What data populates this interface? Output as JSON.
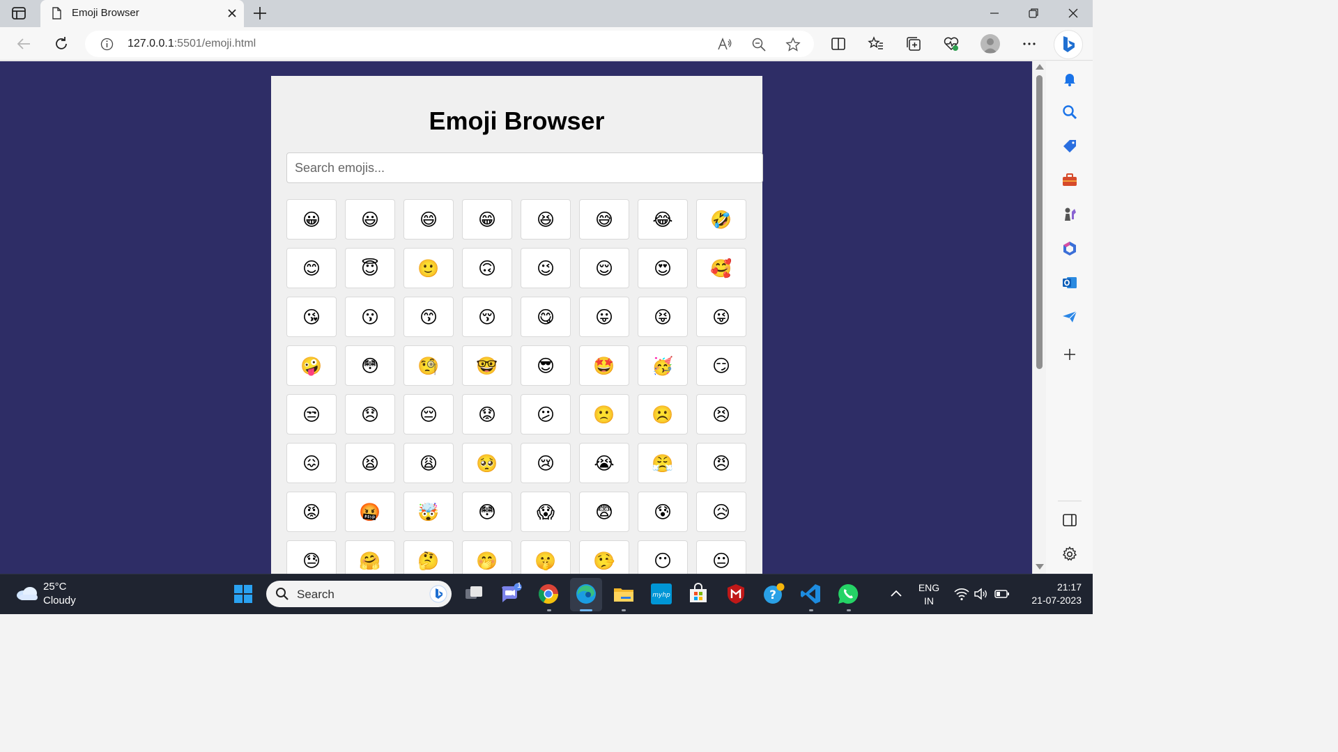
{
  "browser": {
    "tab_title": "Emoji Browser",
    "url_host": "127.0.0.1",
    "url_rest": ":5501/emoji.html"
  },
  "page": {
    "heading": "Emoji Browser",
    "search_placeholder": "Search emojis...",
    "emojis": [
      "😀",
      "😃",
      "😄",
      "😁",
      "😆",
      "😅",
      "😂",
      "🤣",
      "😊",
      "😇",
      "🙂",
      "🙃",
      "😉",
      "😌",
      "😍",
      "🥰",
      "😘",
      "😗",
      "😙",
      "😚",
      "😋",
      "😛",
      "😝",
      "😜",
      "🤪",
      "😳",
      "🧐",
      "🤓",
      "😎",
      "🤩",
      "🥳",
      "😏",
      "😒",
      "😞",
      "😔",
      "😟",
      "😕",
      "🙁",
      "☹️",
      "😣",
      "😖",
      "😫",
      "😩",
      "🥺",
      "😢",
      "😭",
      "😤",
      "😠",
      "😡",
      "🤬",
      "🤯",
      "😳",
      "😱",
      "😨",
      "😰",
      "😥",
      "😓",
      "🤗",
      "🤔",
      "🤭",
      "🤫",
      "🤥",
      "😶",
      "😐"
    ]
  },
  "taskbar": {
    "temperature": "25°C",
    "weather": "Cloudy",
    "search_label": "Search",
    "language": "ENG",
    "region": "IN",
    "time": "21:17",
    "date": "21-07-2023",
    "teams_badge": "1"
  },
  "colors": {
    "page_background": "#2e2d66",
    "card_background": "#f0f0f0",
    "taskbar": "#1f2430"
  }
}
